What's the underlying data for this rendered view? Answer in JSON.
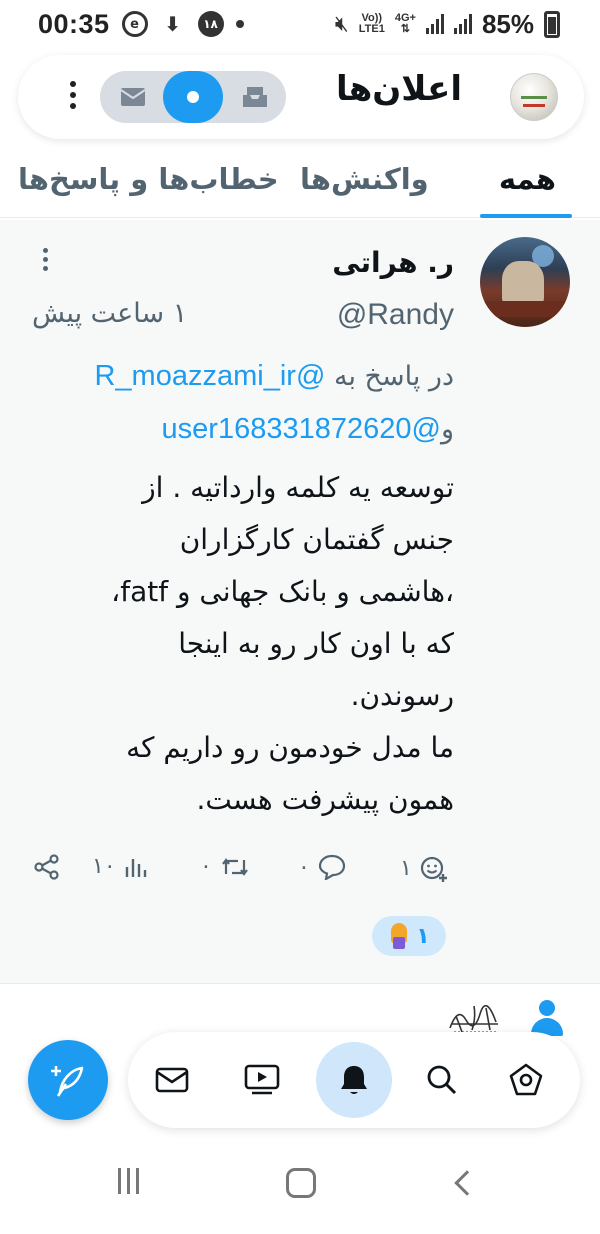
{
  "status_bar": {
    "time": "00:35",
    "notification_badge": "۱۸",
    "network_volte": "Vo))",
    "network_lte": "LTE1",
    "network_gen": "4G+",
    "battery_percent": "85%"
  },
  "header": {
    "title": "اعلان‌ها",
    "segments": [
      "mail-icon",
      "dot-icon",
      "inbox-icon"
    ],
    "active_segment": "dot-icon"
  },
  "tabs": {
    "all": "همه",
    "reactions": "واکنش‌ها",
    "mentions": "خطاب‌ها و پاسخ‌ها",
    "active": "همه"
  },
  "post": {
    "author_name": "ر. هراتی",
    "author_handle": "@Randy",
    "time_ago": "۱ ساعت پیش",
    "reply_prefix": "در پاسخ به",
    "reply_mention_1": "@R_moazzami_ir",
    "reply_and": "و",
    "reply_mention_2": "@user168331872620",
    "body_lines": [
      "توسعه یه کلمه وارداتیه . از",
      "جنس گفتمان کارگزاران",
      "،هاشمی و بانک جهانی و fatf،",
      "که با اون کار رو به اینجا",
      "رسوندن.",
      "ما مدل خودمون رو داریم که",
      "همون پیشرفت هست."
    ],
    "actions": {
      "views": "۱۰",
      "retweets": "۰",
      "replies": "۰",
      "reactions": "۱"
    },
    "reaction_pill_count": "۱"
  },
  "colors": {
    "accent": "#1d9bf0",
    "text_primary": "#0f1419",
    "text_secondary": "#536471",
    "card_bg": "#f7f9f9"
  }
}
